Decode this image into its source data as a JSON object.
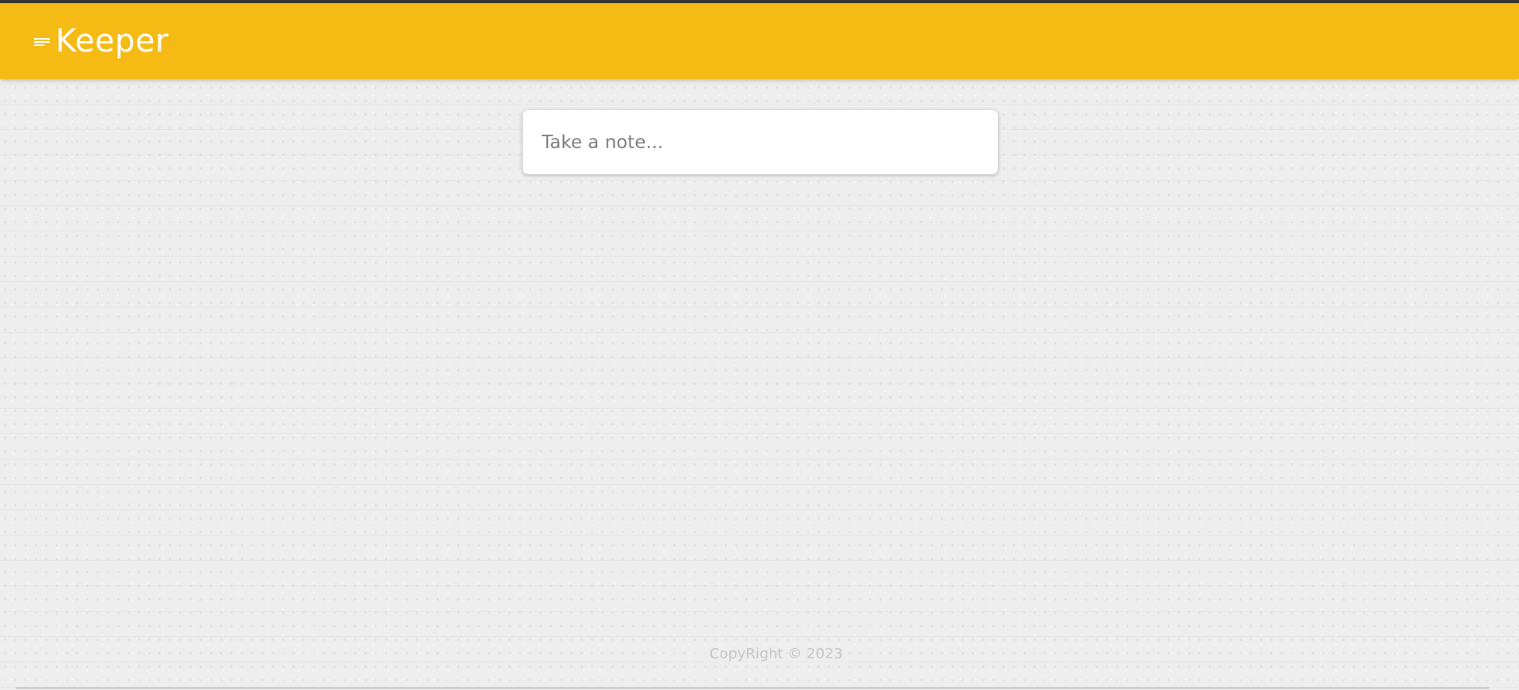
{
  "header": {
    "title": "Keeper",
    "icon": "notes-icon",
    "background_color": "#f5ba13"
  },
  "create_note": {
    "placeholder": "Take a note...",
    "value": ""
  },
  "footer": {
    "copyright": "CopyRight © 2023"
  }
}
